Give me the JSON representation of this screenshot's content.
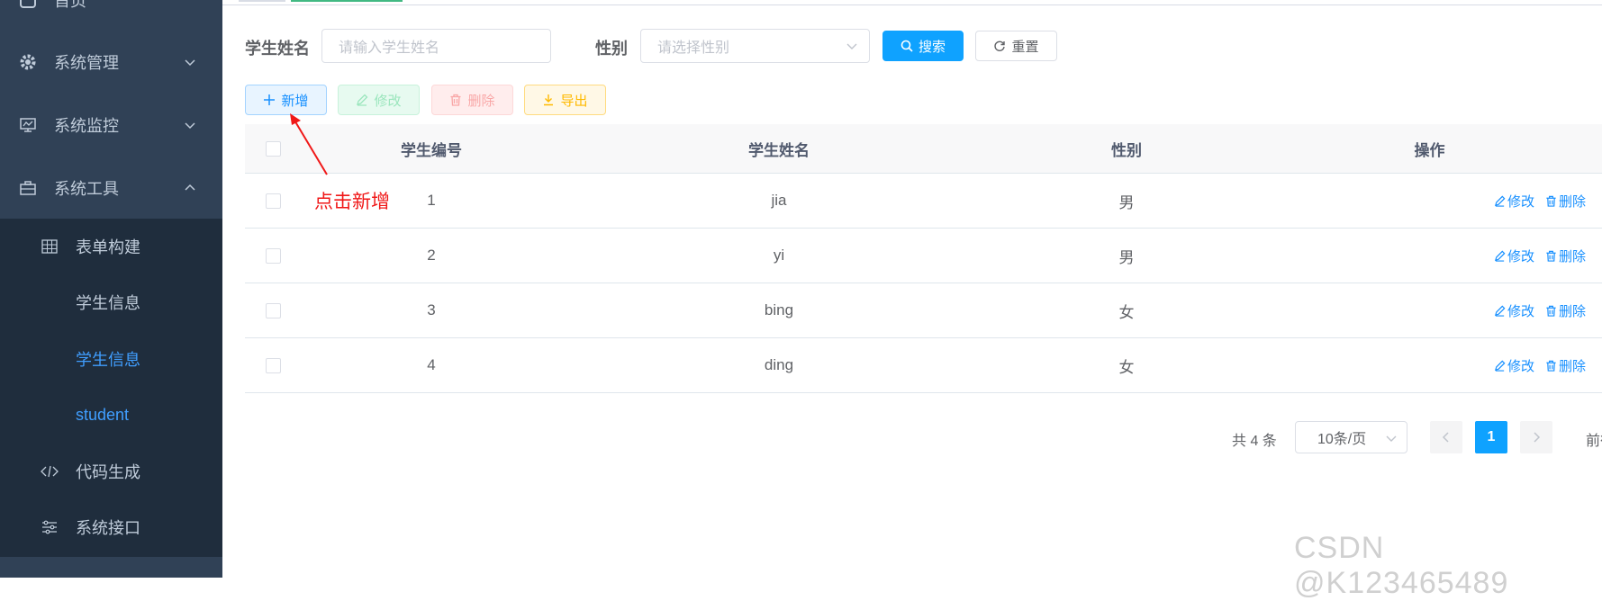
{
  "sidebar": {
    "items": [
      {
        "label": "首页",
        "icon": "dashboard-icon"
      },
      {
        "label": "系统管理",
        "icon": "gear-icon"
      },
      {
        "label": "系统监控",
        "icon": "monitor-icon"
      },
      {
        "label": "系统工具",
        "icon": "toolbox-icon"
      }
    ],
    "sub_items": [
      {
        "label": "表单构建",
        "icon": "table-icon"
      },
      {
        "label": "学生信息"
      },
      {
        "label": "学生信息",
        "active": true
      },
      {
        "label": "student",
        "active": true
      },
      {
        "label": "代码生成",
        "icon": "code-icon"
      },
      {
        "label": "系统接口",
        "icon": "sliders-icon"
      }
    ]
  },
  "search": {
    "name_label": "学生姓名",
    "name_placeholder": "请输入学生姓名",
    "gender_label": "性别",
    "gender_placeholder": "请选择性别",
    "search_button": "搜索",
    "reset_button": "重置"
  },
  "toolbar": {
    "add": "新增",
    "edit": "修改",
    "delete": "删除",
    "export": "导出"
  },
  "table": {
    "columns": [
      "学生编号",
      "学生姓名",
      "性别",
      "操作"
    ],
    "rows": [
      {
        "id": "1",
        "name": "jia",
        "gender": "男"
      },
      {
        "id": "2",
        "name": "yi",
        "gender": "男"
      },
      {
        "id": "3",
        "name": "bing",
        "gender": "女"
      },
      {
        "id": "4",
        "name": "ding",
        "gender": "女"
      }
    ],
    "row_edit": "修改",
    "row_delete": "删除"
  },
  "pagination": {
    "total": "共 4 条",
    "page_size": "10条/页",
    "current_page": "1",
    "jump_label": "前往"
  },
  "annotation": "点击新增",
  "watermark": "CSDN @K123465489",
  "colors": {
    "sidebar_bg": "#304156",
    "submenu_bg": "#1f2d3d",
    "primary": "#0fa2ff",
    "annotation": "#f01818"
  }
}
